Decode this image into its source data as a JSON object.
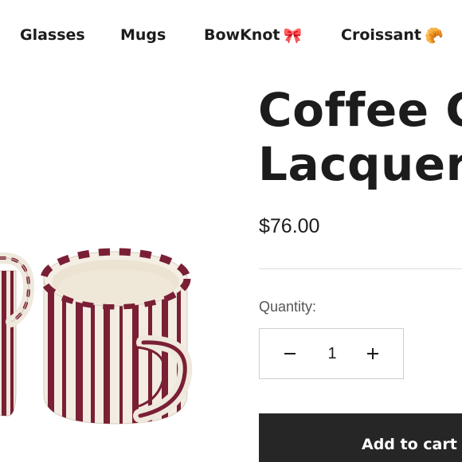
{
  "nav": {
    "items": [
      {
        "label": "Glasses",
        "emoji": ""
      },
      {
        "label": "Mugs",
        "emoji": ""
      },
      {
        "label": "BowKnot",
        "emoji": "🎀"
      },
      {
        "label": "Croissant",
        "emoji": "🥐"
      }
    ]
  },
  "product": {
    "title_line1": "Coffee C",
    "title_line2": "Lacquer",
    "price": "$76.00",
    "image_icon": "striped-mug-image",
    "colors": {
      "stripe": "#7a1f35",
      "ceramic": "#efe8dc",
      "button_bg": "#262626"
    }
  },
  "quantity": {
    "label": "Quantity:",
    "value": "1"
  },
  "cart": {
    "add_label": "Add to cart"
  }
}
